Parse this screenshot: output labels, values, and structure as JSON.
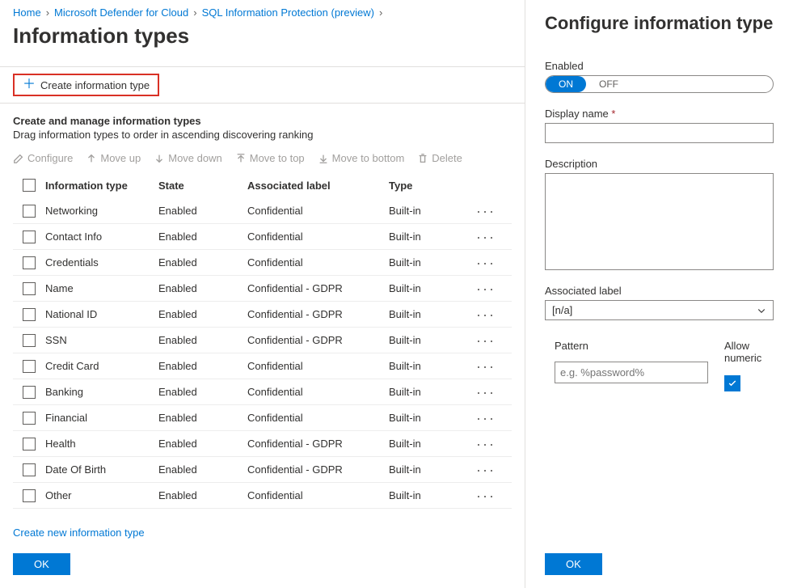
{
  "breadcrumb": {
    "items": [
      "Home",
      "Microsoft Defender for Cloud",
      "SQL Information Protection (preview)"
    ]
  },
  "page_title": "Information types",
  "create_btn": "Create information type",
  "section": {
    "header": "Create and manage information types",
    "desc": "Drag information types to order in ascending discovering ranking"
  },
  "toolbar": {
    "configure": "Configure",
    "move_up": "Move up",
    "move_down": "Move down",
    "move_top": "Move to top",
    "move_bottom": "Move to bottom",
    "delete": "Delete"
  },
  "columns": {
    "info_type": "Information type",
    "state": "State",
    "assoc_label": "Associated label",
    "type": "Type"
  },
  "rows": [
    {
      "name": "Networking",
      "state": "Enabled",
      "label": "Confidential",
      "type": "Built-in"
    },
    {
      "name": "Contact Info",
      "state": "Enabled",
      "label": "Confidential",
      "type": "Built-in"
    },
    {
      "name": "Credentials",
      "state": "Enabled",
      "label": "Confidential",
      "type": "Built-in"
    },
    {
      "name": "Name",
      "state": "Enabled",
      "label": "Confidential - GDPR",
      "type": "Built-in"
    },
    {
      "name": "National ID",
      "state": "Enabled",
      "label": "Confidential - GDPR",
      "type": "Built-in"
    },
    {
      "name": "SSN",
      "state": "Enabled",
      "label": "Confidential - GDPR",
      "type": "Built-in"
    },
    {
      "name": "Credit Card",
      "state": "Enabled",
      "label": "Confidential",
      "type": "Built-in"
    },
    {
      "name": "Banking",
      "state": "Enabled",
      "label": "Confidential",
      "type": "Built-in"
    },
    {
      "name": "Financial",
      "state": "Enabled",
      "label": "Confidential",
      "type": "Built-in"
    },
    {
      "name": "Health",
      "state": "Enabled",
      "label": "Confidential - GDPR",
      "type": "Built-in"
    },
    {
      "name": "Date Of Birth",
      "state": "Enabled",
      "label": "Confidential - GDPR",
      "type": "Built-in"
    },
    {
      "name": "Other",
      "state": "Enabled",
      "label": "Confidential",
      "type": "Built-in"
    }
  ],
  "create_link": "Create new information type",
  "ok": "OK",
  "panel": {
    "title": "Configure information type",
    "enabled_label": "Enabled",
    "toggle": {
      "on": "ON",
      "off": "OFF"
    },
    "display_name_label": "Display name",
    "description_label": "Description",
    "assoc_label": "Associated label",
    "assoc_value": "[n/a]",
    "pattern_label": "Pattern",
    "pattern_placeholder": "e.g. %password%",
    "allow_numeric_label": "Allow numeric"
  }
}
